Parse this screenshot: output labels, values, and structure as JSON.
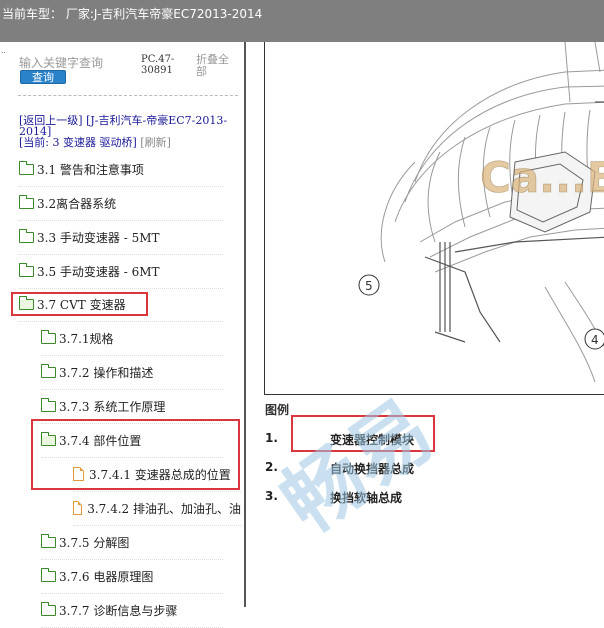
{
  "window": {
    "title": "当前车型： 厂家:J-吉利汽车帝豪EC72013-2014"
  },
  "sidebar": {
    "search_placeholder": "输入关键字查询",
    "search_button": "查询",
    "pc_code": "PC.47-30891",
    "collapse_all": "折叠全部",
    "crumbs": {
      "back": "[返回上一级]",
      "back_target": "[J-吉利汽车-帝豪EC7-2013-2014]",
      "current": "[当前: 3 变速器 驱动桥]",
      "refresh": "[刷新]"
    },
    "items": [
      {
        "label": "3.1 警告和注意事项",
        "icon": "folder-icon"
      },
      {
        "label": "3.2离合器系统",
        "icon": "folder-icon"
      },
      {
        "label": "3.3 手动变速器 - 5MT",
        "icon": "folder-icon"
      },
      {
        "label": "3.5 手动变速器 - 6MT",
        "icon": "folder-icon"
      },
      {
        "label": "3.7 CVT 变速器",
        "icon": "folder-open-icon"
      },
      {
        "label": "3.7.1规格",
        "icon": "folder-icon"
      },
      {
        "label": "3.7.2 操作和描述",
        "icon": "folder-icon"
      },
      {
        "label": "3.7.3 系统工作原理",
        "icon": "folder-icon"
      },
      {
        "label": "3.7.4 部件位置",
        "icon": "folder-open-icon"
      },
      {
        "label": "3.7.4.1 变速器总成的位置",
        "icon": "document-icon"
      },
      {
        "label": "3.7.4.2 排油孔、加油孔、油",
        "icon": "document-icon"
      },
      {
        "label": "3.7.5 分解图",
        "icon": "folder-icon"
      },
      {
        "label": "3.7.6 电器原理图",
        "icon": "folder-icon"
      },
      {
        "label": "3.7.7 诊断信息与步骤",
        "icon": "folder-icon"
      }
    ]
  },
  "content": {
    "callouts": [
      "5",
      "4"
    ],
    "legend_title": "图例",
    "legend": [
      {
        "num": "1.",
        "text": "变速器控制模块"
      },
      {
        "num": "2.",
        "text": "自动换挡器总成"
      },
      {
        "num": "3.",
        "text": "换挡软轴总成"
      }
    ],
    "watermark_image": "Ca...Be",
    "watermark_text": "畅易"
  },
  "colors": {
    "titlebar": "#7f7f7f",
    "highlight_box": "#d9363e",
    "search_button": "#2a82c9",
    "folder_icon": "#3a8a2a",
    "document_icon": "#e39a3a"
  }
}
